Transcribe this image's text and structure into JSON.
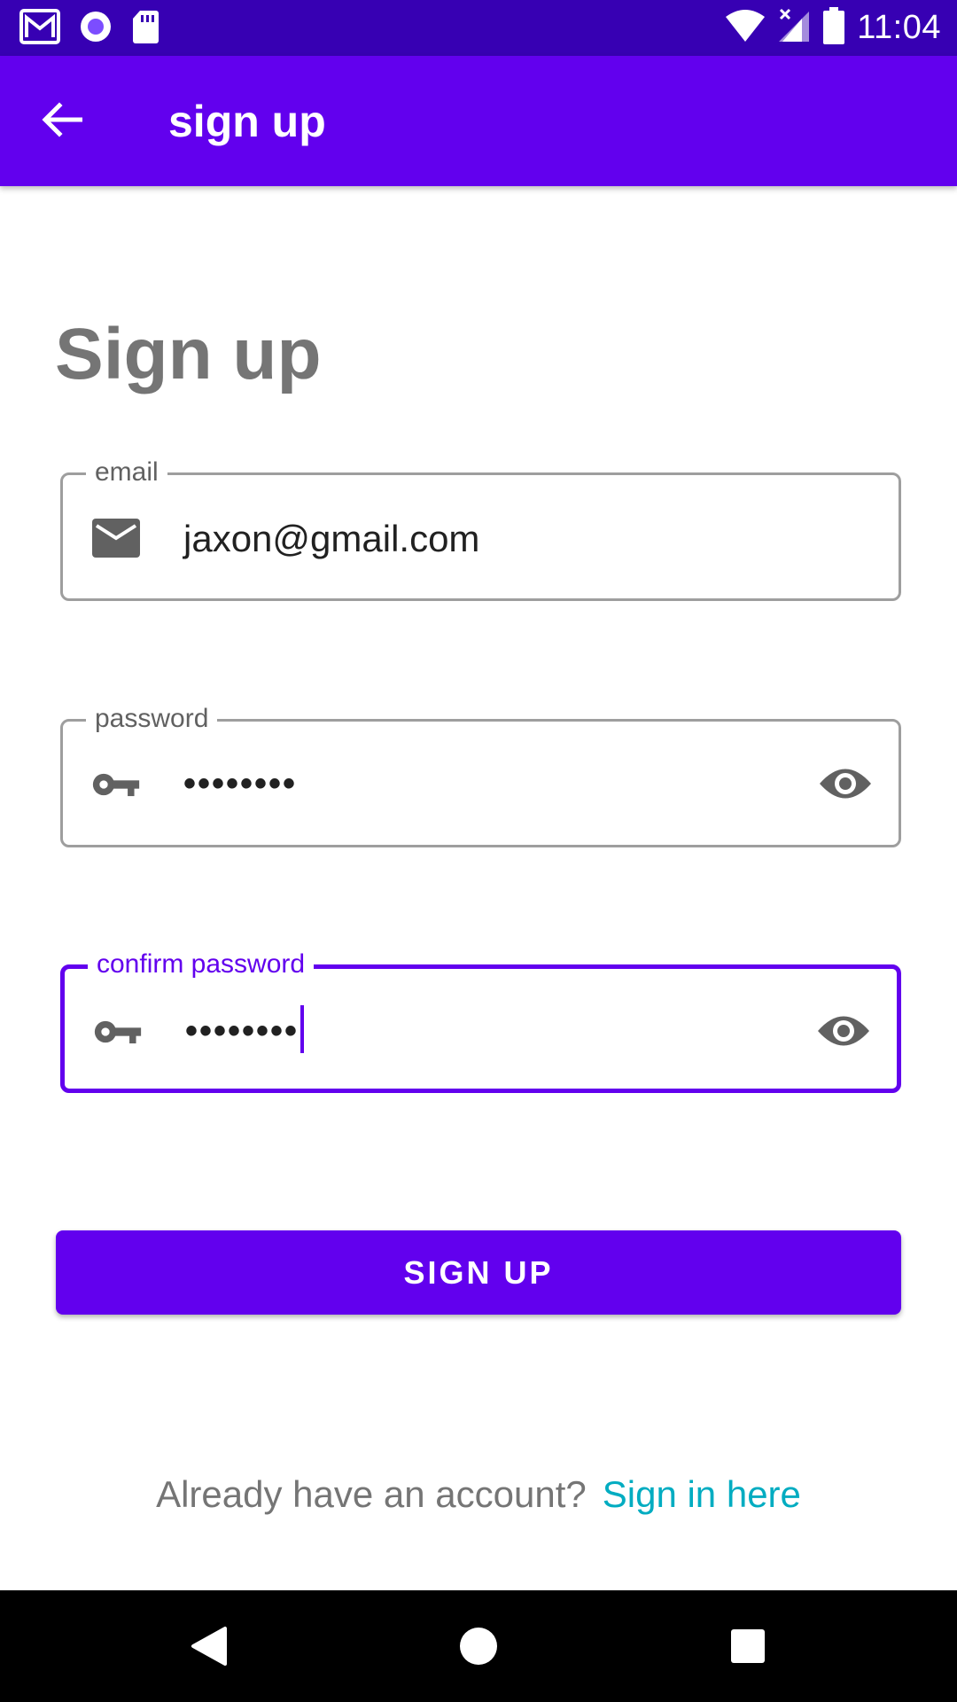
{
  "status_bar": {
    "time": "11:04",
    "left_icons": [
      "gmail-icon",
      "record-icon",
      "sd-card-icon"
    ],
    "right_icons": [
      "wifi-icon",
      "signal-icon",
      "battery-icon"
    ]
  },
  "app_bar": {
    "title": "sign up",
    "back_icon": "arrow-back-icon"
  },
  "heading": "Sign up",
  "fields": {
    "email": {
      "label": "email",
      "value": "jaxon@gmail.com",
      "leading_icon": "email-icon"
    },
    "password": {
      "label": "password",
      "value": "••••••••",
      "leading_icon": "key-icon",
      "trailing_icon": "eye-icon"
    },
    "confirm_password": {
      "label": "confirm password",
      "value": "••••••••",
      "leading_icon": "key-icon",
      "trailing_icon": "eye-icon",
      "focused": true
    }
  },
  "signup_button": {
    "label": "SIGN UP"
  },
  "footer": {
    "prompt": "Already have an account?",
    "link": "Sign in here"
  },
  "nav_bar": {
    "buttons": [
      "back-triangle-icon",
      "home-circle-icon",
      "recents-square-icon"
    ]
  },
  "colors": {
    "status_bar": "#3700b3",
    "primary": "#6200ee",
    "link": "#00acc1",
    "heading": "#757575"
  }
}
